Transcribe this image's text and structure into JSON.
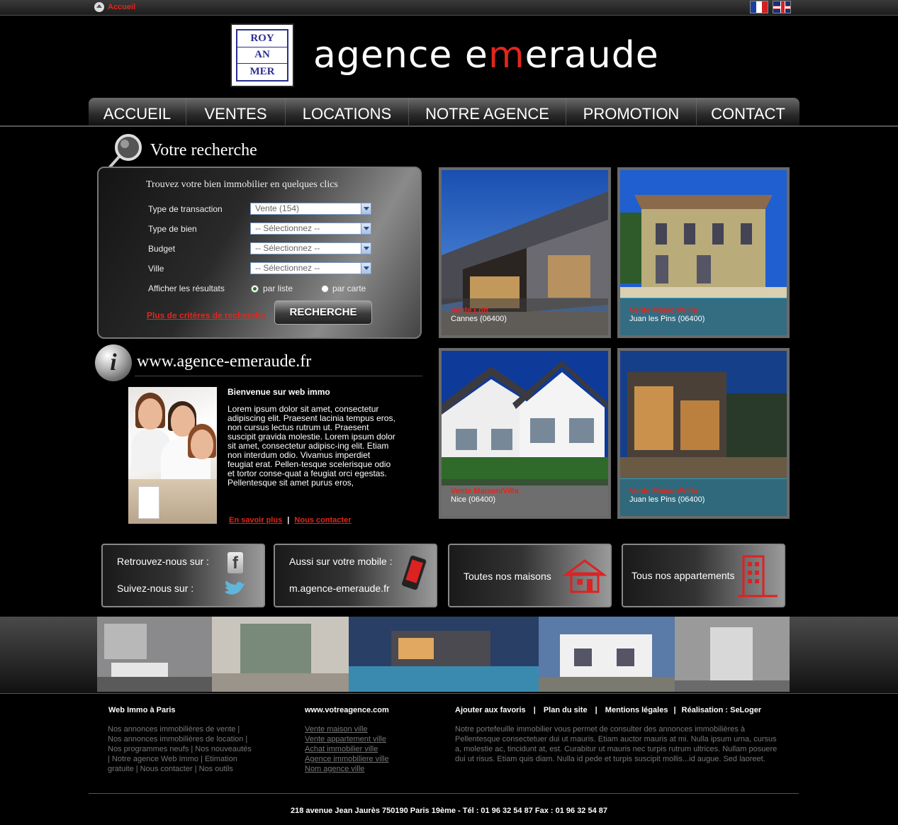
{
  "topbar": {
    "home_label": "Accueil"
  },
  "logo": {
    "cells": [
      "ROY",
      "",
      "",
      "AN",
      "",
      "",
      "MER",
      "",
      ""
    ],
    "brand_part1": "agence e",
    "brand_m": "m",
    "brand_part2": "eraude"
  },
  "nav": {
    "items": [
      "ACCUEIL",
      "VENTES",
      "LOCATIONS",
      "NOTRE AGENCE",
      "PROMOTION",
      "CONTACT"
    ]
  },
  "search": {
    "title": "Votre recherche",
    "subtitle": "Trouvez votre bien immobilier en quelques clics",
    "fields": [
      {
        "label": "Type de transaction",
        "value": "Vente (154)"
      },
      {
        "label": "Type de bien",
        "value": "-- Sélectionnez --"
      },
      {
        "label": "Budget",
        "value": "-- Sélectionnez --"
      },
      {
        "label": "Ville",
        "value": "-- Sélectionnez --"
      }
    ],
    "display_label": "Afficher les résultats",
    "display_options": [
      "par liste",
      "par carte"
    ],
    "more_criteria": "Plus de critères de recherche",
    "button": "RECHERCHE"
  },
  "info": {
    "site_url": "www.agence-emeraude.fr",
    "welcome_title": "Bienvenue sur web immo",
    "welcome_text": "Lorem ipsum dolor sit amet, consectetur adipiscing elit. Praesent lacinia tempus eros, non cursus lectus rutrum ut. Praesent suscipit gravida molestie. Lorem ipsum dolor sit amet, consectetur adipisc-ing elit. Etiam non interdum odio. Vivamus imperdiet feugiat erat. Pellen-tesque scelerisque odio et tortor conse-quat a feugiat orci egestas. Pellentesque sit amet purus eros,",
    "link_more": "En savoir plus",
    "separator": "|",
    "link_contact": "Nous contacter"
  },
  "properties": [
    {
      "type": "Vente Loft",
      "location": "Cannes (06400)"
    },
    {
      "type": "Vente Maison/Villa",
      "location": "Juan les Pins (06400)"
    },
    {
      "type": "Vente Maison/Villa",
      "location": "Nice (06400)"
    },
    {
      "type": "Vente Maison/Villa",
      "location": "Juan les Pins (06400)"
    }
  ],
  "promos": {
    "social_find": "Retrouvez-nous sur :",
    "social_follow": "Suivez-nous sur :",
    "mobile_title": "Aussi sur votre mobile :",
    "mobile_url": "m.agence-emeraude.fr",
    "houses": "Toutes nos maisons",
    "apartments": "Tous nos appartements"
  },
  "footer": {
    "col1_title": "Web Immo à Paris",
    "col1_text": "Nos annonces immobilières de vente | Nos annonces immobilières de location | Nos programmes neufs | Nos nouveautés | Notre agence Web Immo | Etimation gratuite | Nous contacter | Nos outils",
    "col2_title": "www.votreagence.com",
    "col2_links": [
      "Vente maison ville",
      "Vente appartement ville",
      "Achat immobilier ville",
      "Agence immobiliere ville",
      "Nom agence ville"
    ],
    "col3_links": [
      "Ajouter aux favoris",
      "Plan du site",
      "Mentions légales",
      "Réalisation : SeLoger"
    ],
    "col3_text": "Notre portefeuille immobilier vous permet de consulter des annonces immobilières à Pellentesque consectetuer dui ut mauris. Etiam auctor mauris at mi. Nulla ipsum urna, cursus a, molestie ac, tincidunt at, est. Curabitur ut mauris nec turpis rutrum ultrices. Nullam posuere dui ut risus. Etiam quis diam. Nulla id pede et turpis suscipit mollis...id augue. Sed laoreet.",
    "address": "218 avenue Jean Jaurès 750190 Paris 19ème -  Tél : 01 96 32 54 87  Fax : 01 96 32 54 87"
  }
}
